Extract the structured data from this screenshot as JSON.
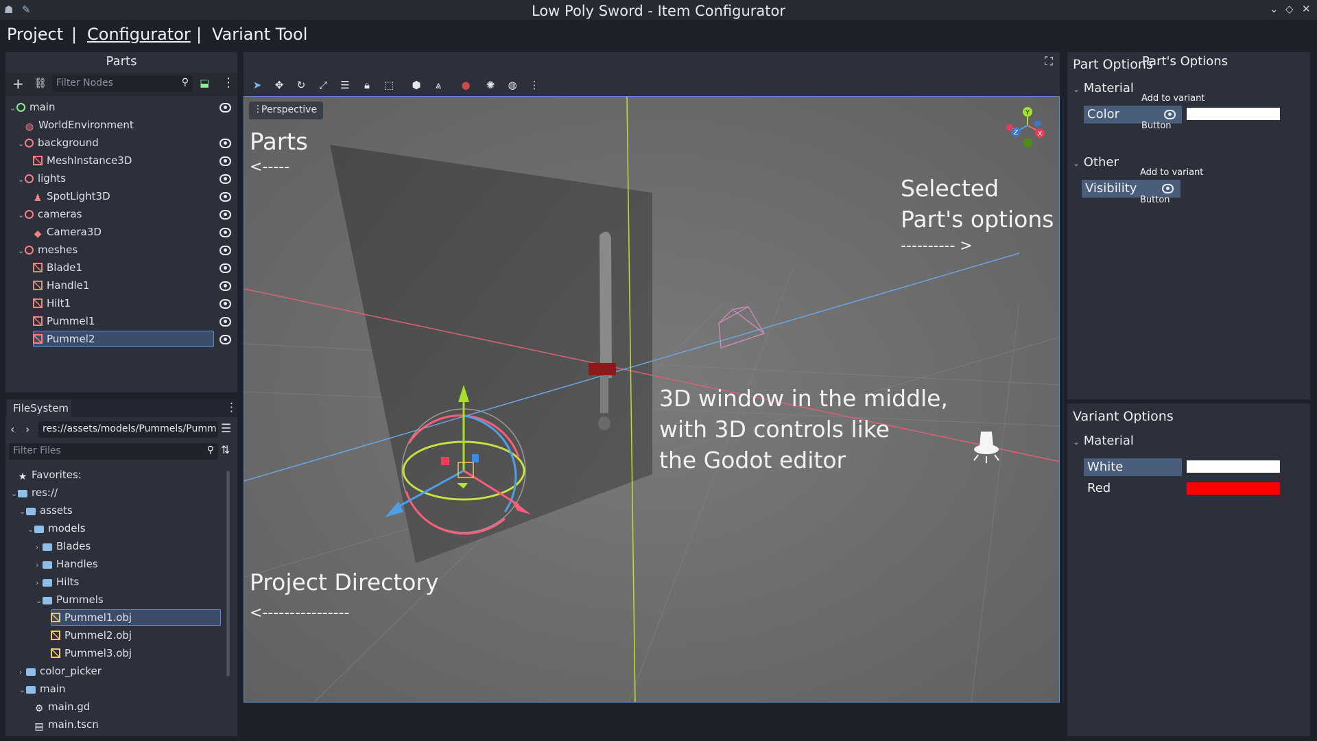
{
  "window": {
    "title": "Low Poly Sword - Item Configurator"
  },
  "menu": {
    "items": [
      "Project",
      "|",
      "Configurator",
      "|",
      "Variant Tool"
    ]
  },
  "parts_panel": {
    "title": "Parts",
    "filter_placeholder": "Filter Nodes",
    "tree": [
      {
        "label": "main",
        "depth": 0,
        "icon": "node3d-green-icon",
        "eye": true,
        "expanded": true
      },
      {
        "label": "WorldEnvironment",
        "depth": 1,
        "icon": "world-environment-icon",
        "eye": false
      },
      {
        "label": "background",
        "depth": 1,
        "icon": "node3d-icon",
        "eye": true,
        "expanded": true
      },
      {
        "label": "MeshInstance3D",
        "depth": 2,
        "icon": "mesh-icon",
        "eye": true
      },
      {
        "label": "lights",
        "depth": 1,
        "icon": "node3d-icon",
        "eye": true,
        "expanded": true
      },
      {
        "label": "SpotLight3D",
        "depth": 2,
        "icon": "spotlight-icon",
        "eye": true
      },
      {
        "label": "cameras",
        "depth": 1,
        "icon": "node3d-icon",
        "eye": true,
        "expanded": true
      },
      {
        "label": "Camera3D",
        "depth": 2,
        "icon": "camera-icon",
        "eye": true
      },
      {
        "label": "meshes",
        "depth": 1,
        "icon": "node3d-icon",
        "eye": true,
        "expanded": true
      },
      {
        "label": "Blade1",
        "depth": 2,
        "icon": "mesh-icon",
        "eye": true
      },
      {
        "label": "Handle1",
        "depth": 2,
        "icon": "mesh-icon",
        "eye": true
      },
      {
        "label": "Hilt1",
        "depth": 2,
        "icon": "mesh-icon",
        "eye": true
      },
      {
        "label": "Pummel1",
        "depth": 2,
        "icon": "mesh-icon",
        "eye": true
      },
      {
        "label": "Pummel2",
        "depth": 2,
        "icon": "mesh-icon",
        "eye": true,
        "selected": true
      }
    ]
  },
  "filesystem": {
    "tab": "FileSystem",
    "path": "res://assets/models/Pummels/Pumm",
    "filter_placeholder": "Filter Files",
    "tree": [
      {
        "label": "Favorites:",
        "depth": 0,
        "icon": "star-icon"
      },
      {
        "label": "res://",
        "depth": 0,
        "icon": "folder-icon",
        "expanded": true
      },
      {
        "label": "assets",
        "depth": 1,
        "icon": "folder-icon",
        "expanded": true
      },
      {
        "label": "models",
        "depth": 2,
        "icon": "folder-icon",
        "expanded": true
      },
      {
        "label": "Blades",
        "depth": 3,
        "icon": "folder-icon",
        "collapsed": true
      },
      {
        "label": "Handles",
        "depth": 3,
        "icon": "folder-icon",
        "collapsed": true
      },
      {
        "label": "Hilts",
        "depth": 3,
        "icon": "folder-icon",
        "collapsed": true
      },
      {
        "label": "Pummels",
        "depth": 3,
        "icon": "folder-icon",
        "expanded": true
      },
      {
        "label": "Pummel1.obj",
        "depth": 4,
        "icon": "obj-file-icon",
        "selected": true
      },
      {
        "label": "Pummel2.obj",
        "depth": 4,
        "icon": "obj-file-icon"
      },
      {
        "label": "Pummel3.obj",
        "depth": 4,
        "icon": "obj-file-icon"
      },
      {
        "label": "color_picker",
        "depth": 1,
        "icon": "folder-icon",
        "collapsed": true
      },
      {
        "label": "main",
        "depth": 1,
        "icon": "folder-icon",
        "expanded": true
      },
      {
        "label": "main.gd",
        "depth": 2,
        "icon": "gear-icon"
      },
      {
        "label": "main.tscn",
        "depth": 2,
        "icon": "scene-icon"
      }
    ]
  },
  "viewport": {
    "perspective_label": "Perspective",
    "annotations": {
      "parts": "Parts",
      "parts_arrow": "<-----",
      "selected_line1": "Selected",
      "selected_line2": "Part's options",
      "selected_arrow": "---------- >",
      "middle_line1": "3D window in the middle,",
      "middle_line2": "with 3D controls like",
      "middle_line3": "the Godot editor",
      "project_dir": "Project Directory",
      "project_arrow": "<----------------"
    },
    "gizmo_axes": [
      "Y",
      "Z",
      "X"
    ]
  },
  "part_options": {
    "title": "Part Options",
    "overlay_title": "Part's Options",
    "sections": [
      {
        "title": "Material",
        "button": "Color",
        "add_label": "Add to variant",
        "button_label": "Button",
        "swatch": "#ffffff"
      },
      {
        "title": "Other",
        "button": "Visibility",
        "add_label": "Add to variant",
        "button_label": "Button"
      }
    ]
  },
  "variant_options": {
    "title": "Variant Options",
    "section": "Material",
    "items": [
      {
        "label": "White",
        "color": "#ffffff",
        "selected": true
      },
      {
        "label": "Red",
        "color": "#ff0000"
      }
    ]
  },
  "colors": {
    "accent": "#4a5d7b",
    "selection": "#3b4d6b",
    "panel": "#2b303a",
    "background": "#1d2129"
  }
}
